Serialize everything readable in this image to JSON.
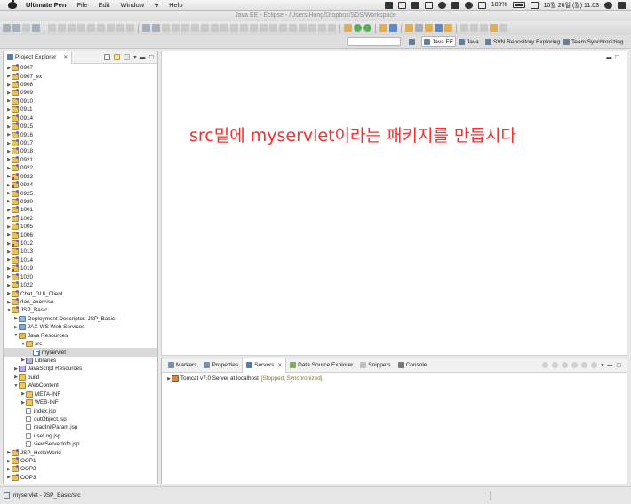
{
  "menubar": {
    "app": "Ultimate Pen",
    "items": [
      "File",
      "Edit",
      "Window",
      "Help"
    ],
    "battery": "100%",
    "clock": "10월 26일 (월) 11:03"
  },
  "window": {
    "title": "Java EE - Eclipse - /Users/Hong/Dropbox/SDS/Workspace"
  },
  "perspectives": [
    {
      "label": "Java EE",
      "active": true
    },
    {
      "label": "Java",
      "active": false
    },
    {
      "label": "SVN Repository Exploring",
      "active": false
    },
    {
      "label": "Team Synchronizing",
      "active": false
    }
  ],
  "explorer": {
    "title": "Project Explorer",
    "rows": [
      {
        "label": "0907",
        "indent": 0,
        "twisty": "closed",
        "icon": "project"
      },
      {
        "label": "0907_ex",
        "indent": 0,
        "twisty": "closed",
        "icon": "project"
      },
      {
        "label": "0908",
        "indent": 0,
        "twisty": "closed",
        "icon": "project"
      },
      {
        "label": "0909",
        "indent": 0,
        "twisty": "closed",
        "icon": "project"
      },
      {
        "label": "0910",
        "indent": 0,
        "twisty": "closed",
        "icon": "project"
      },
      {
        "label": "0911",
        "indent": 0,
        "twisty": "closed",
        "icon": "project"
      },
      {
        "label": "0914",
        "indent": 0,
        "twisty": "closed",
        "icon": "project"
      },
      {
        "label": "0915",
        "indent": 0,
        "twisty": "closed",
        "icon": "project"
      },
      {
        "label": "0916",
        "indent": 0,
        "twisty": "closed",
        "icon": "project"
      },
      {
        "label": "0917",
        "indent": 0,
        "twisty": "closed",
        "icon": "project"
      },
      {
        "label": "0918",
        "indent": 0,
        "twisty": "closed",
        "icon": "project"
      },
      {
        "label": "0921",
        "indent": 0,
        "twisty": "closed",
        "icon": "project"
      },
      {
        "label": "0922",
        "indent": 0,
        "twisty": "closed",
        "icon": "project"
      },
      {
        "label": "0923",
        "indent": 0,
        "twisty": "closed",
        "icon": "project-err"
      },
      {
        "label": "0924",
        "indent": 0,
        "twisty": "closed",
        "icon": "project-err"
      },
      {
        "label": "0925",
        "indent": 0,
        "twisty": "closed",
        "icon": "project"
      },
      {
        "label": "0930",
        "indent": 0,
        "twisty": "closed",
        "icon": "project"
      },
      {
        "label": "1001",
        "indent": 0,
        "twisty": "closed",
        "icon": "project"
      },
      {
        "label": "1002",
        "indent": 0,
        "twisty": "closed",
        "icon": "project"
      },
      {
        "label": "1005",
        "indent": 0,
        "twisty": "closed",
        "icon": "project"
      },
      {
        "label": "1006",
        "indent": 0,
        "twisty": "closed",
        "icon": "project"
      },
      {
        "label": "1012",
        "indent": 0,
        "twisty": "closed",
        "icon": "project-err"
      },
      {
        "label": "1013",
        "indent": 0,
        "twisty": "closed",
        "icon": "project"
      },
      {
        "label": "1014",
        "indent": 0,
        "twisty": "closed",
        "icon": "project"
      },
      {
        "label": "1019",
        "indent": 0,
        "twisty": "closed",
        "icon": "project-err"
      },
      {
        "label": "1020",
        "indent": 0,
        "twisty": "closed",
        "icon": "project"
      },
      {
        "label": "1022",
        "indent": 0,
        "twisty": "closed",
        "icon": "project"
      },
      {
        "label": "Chat_GUI_Client",
        "indent": 0,
        "twisty": "closed",
        "icon": "project"
      },
      {
        "label": "dao_exercise",
        "indent": 0,
        "twisty": "closed",
        "icon": "project"
      },
      {
        "label": "JSP_Basic",
        "indent": 0,
        "twisty": "open",
        "icon": "project"
      },
      {
        "label": "Deployment Descriptor: JSP_Basic",
        "indent": 1,
        "twisty": "closed",
        "icon": "descriptor"
      },
      {
        "label": "JAX-WS Web Services",
        "indent": 1,
        "twisty": "closed",
        "icon": "ws"
      },
      {
        "label": "Java Resources",
        "indent": 1,
        "twisty": "open",
        "icon": "resources"
      },
      {
        "label": "src",
        "indent": 2,
        "twisty": "open",
        "icon": "srcfolder"
      },
      {
        "label": "myservlet",
        "indent": 3,
        "twisty": "none",
        "icon": "package",
        "selected": true
      },
      {
        "label": "Libraries",
        "indent": 2,
        "twisty": "closed",
        "icon": "library"
      },
      {
        "label": "JavaScript Resources",
        "indent": 1,
        "twisty": "closed",
        "icon": "library"
      },
      {
        "label": "build",
        "indent": 1,
        "twisty": "closed",
        "icon": "folder"
      },
      {
        "label": "WebContent",
        "indent": 1,
        "twisty": "open",
        "icon": "folder"
      },
      {
        "label": "META-INF",
        "indent": 2,
        "twisty": "closed",
        "icon": "folder"
      },
      {
        "label": "WEB-INF",
        "indent": 2,
        "twisty": "closed",
        "icon": "folder"
      },
      {
        "label": "index.jsp",
        "indent": 2,
        "twisty": "none",
        "icon": "file"
      },
      {
        "label": "outObject.jsp",
        "indent": 2,
        "twisty": "none",
        "icon": "file"
      },
      {
        "label": "readInitParam.jsp",
        "indent": 2,
        "twisty": "none",
        "icon": "file"
      },
      {
        "label": "useLog.jsp",
        "indent": 2,
        "twisty": "none",
        "icon": "file"
      },
      {
        "label": "viewServerInfo.jsp",
        "indent": 2,
        "twisty": "none",
        "icon": "file"
      },
      {
        "label": "JSP_HelloWorld",
        "indent": 0,
        "twisty": "closed",
        "icon": "project"
      },
      {
        "label": "OOP1",
        "indent": 0,
        "twisty": "closed",
        "icon": "project"
      },
      {
        "label": "OOP2",
        "indent": 0,
        "twisty": "closed",
        "icon": "project"
      },
      {
        "label": "OOP3",
        "indent": 0,
        "twisty": "closed",
        "icon": "project"
      }
    ]
  },
  "editor": {
    "caption": "src밑에 myservlet이라는 패키지를 만듭시다"
  },
  "views": {
    "tabs": [
      {
        "label": "Markers",
        "icon": "markers",
        "active": false
      },
      {
        "label": "Properties",
        "icon": "properties",
        "active": false
      },
      {
        "label": "Servers",
        "icon": "servers",
        "active": true
      },
      {
        "label": "Data Source Explorer",
        "icon": "dse",
        "active": false
      },
      {
        "label": "Snippets",
        "icon": "snippets",
        "active": false
      },
      {
        "label": "Console",
        "icon": "console",
        "active": false
      }
    ],
    "server": {
      "name": "Tomcat v7.0 Server at localhost",
      "status": "[Stopped, Synchronized]"
    }
  },
  "statusbar": {
    "text": "myservlet - JSP_Basic/src"
  }
}
